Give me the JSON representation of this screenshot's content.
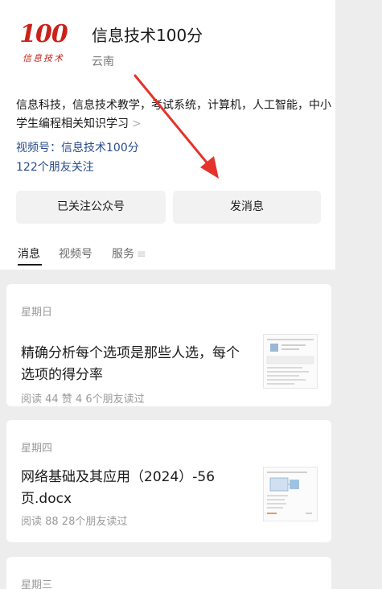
{
  "account": {
    "logo_number": "100",
    "logo_text": "信息技术",
    "name": "信息技术100分",
    "region": "云南",
    "description": "信息科技，信息技术教学，考试系统，计算机，人工智能，中小学生编程相关知识学习",
    "description_chevron": ">",
    "video_channel": "视频号：信息技术100分",
    "friends_following": "122个朋友关注"
  },
  "buttons": {
    "follow": "已关注公众号",
    "message": "发消息"
  },
  "tabs": [
    {
      "label": "消息",
      "active": true
    },
    {
      "label": "视频号",
      "active": false
    },
    {
      "label": "服务",
      "icon": "menu-icon",
      "active": false
    }
  ],
  "tab_menu_glyph": "≡",
  "feed": [
    {
      "day": "星期日",
      "title": "精确分析每个选项是那些人选，每个选项的得分率",
      "meta": "阅读 44  赞 4  6个朋友读过"
    },
    {
      "day": "星期四",
      "title": "网络基础及其应用（2024）-56页.docx",
      "meta": "阅读 88  28个朋友读过"
    },
    {
      "day": "星期三"
    }
  ],
  "colors": {
    "accent_link": "#2a4d8a",
    "logo_red": "#c8231a",
    "annotation_arrow": "#e5332b",
    "feed_background": "#ededed"
  }
}
